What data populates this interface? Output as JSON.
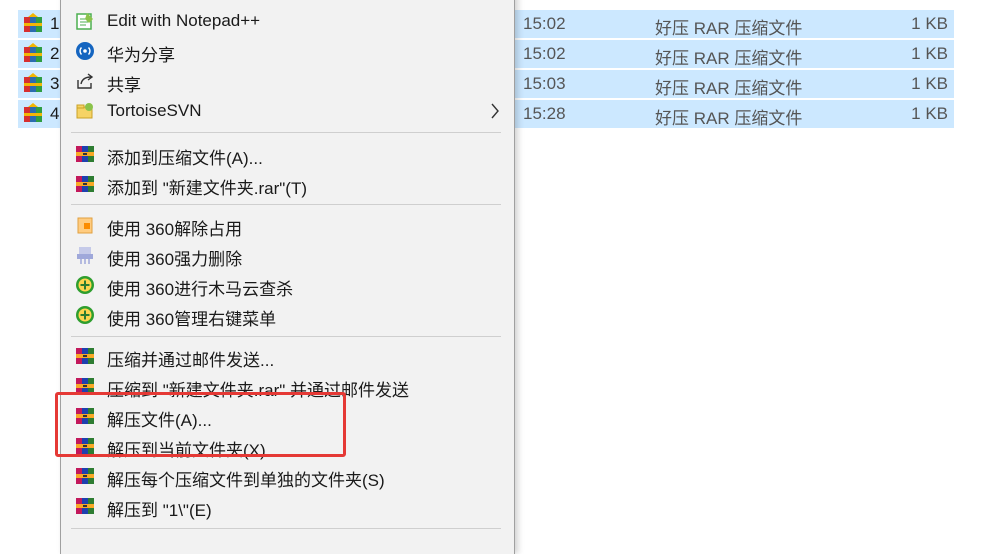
{
  "files": [
    {
      "num": "1",
      "date": "15:02",
      "type": "好压 RAR 压缩文件",
      "size": "1 KB"
    },
    {
      "num": "2",
      "date": "15:02",
      "type": "好压 RAR 压缩文件",
      "size": "1 KB"
    },
    {
      "num": "3",
      "date": "15:03",
      "type": "好压 RAR 压缩文件",
      "size": "1 KB"
    },
    {
      "num": "4",
      "date": "15:28",
      "type": "好压 RAR 压缩文件",
      "size": "1 KB"
    }
  ],
  "menu": {
    "notepad": "Edit with Notepad++",
    "huawei_share": "华为分享",
    "share": "共享",
    "tortoise": "TortoiseSVN",
    "add_archive": "添加到压缩文件(A)...",
    "add_named": "添加到 \"新建文件夹.rar\"(T)",
    "unlock360": "使用 360解除占用",
    "delete360": "使用 360强力删除",
    "scan360": "使用 360进行木马云查杀",
    "manage360": "使用 360管理右键菜单",
    "compress_email": "压缩并通过邮件发送...",
    "compress_named_email": "压缩到 \"新建文件夹.rar\" 并通过邮件发送",
    "extract_files": "解压文件(A)...",
    "extract_here": "解压到当前文件夹(X)",
    "extract_each": "解压每个压缩文件到单独的文件夹(S)",
    "extract_to": "解压到 \"1\\\"(E)"
  },
  "colors": {
    "selection": "#cce8ff",
    "menu_bg": "#f2f2f2",
    "highlight": "#e53935",
    "huawei_blue": "#1565c0",
    "green_360": "#2e9e2e"
  }
}
